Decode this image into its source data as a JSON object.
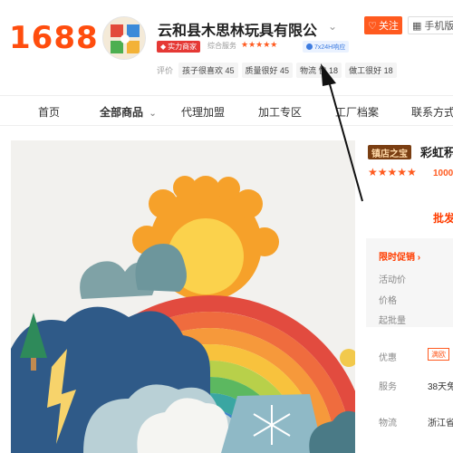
{
  "header": {
    "logo_text": "1688",
    "shop_name": "云和县木思林玩具有限公",
    "follow_label": "关注",
    "mobile_label": "手机版",
    "strength_badge": "实力商家",
    "service_label": "综合服务",
    "service_stars": "★★★★★",
    "service_badge": "7x24H响应",
    "rating_label": "评价",
    "rating_tags": [
      "孩子很喜欢 45",
      "质量很好 45",
      "物流 快 18",
      "做工很好 18"
    ]
  },
  "nav": {
    "items": [
      "首页",
      "全部商品",
      "代理加盟",
      "加工专区",
      "工厂档案",
      "联系方式"
    ]
  },
  "product": {
    "treasure_badge": "镇店之宝",
    "title": "彩虹积",
    "stars": "★★★★★",
    "rating_count": "1000",
    "wholesale_label": "批发",
    "promo_label": "限时促销",
    "activity_price_label": "活动价",
    "price_label": "价格",
    "min_batch_label": "起批量",
    "coupon_label": "优惠",
    "coupon_value": "满欧",
    "service_label": "服务",
    "service_value": "38天免",
    "logistics_label": "物流",
    "logistics_value": "浙江省"
  },
  "colors": {
    "brand": "#ff4d0e",
    "accent": "#ff5a1f",
    "badge_red": "#e53935",
    "service_blue": "#3d7ce0",
    "treasure_brown": "#7a3e12"
  }
}
